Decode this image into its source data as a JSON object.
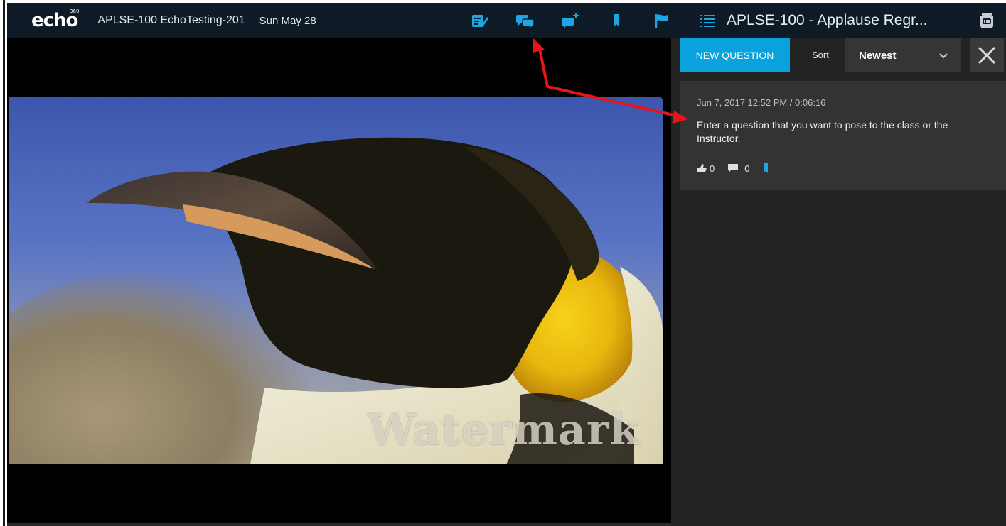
{
  "header": {
    "logo": "echo",
    "logo_sup": "360",
    "course": "APLSE-100 EchoTesting-201",
    "date": "Sun May 28"
  },
  "toolbar": {
    "icons": [
      "notes-icon",
      "discussions-icon",
      "add-question-icon",
      "bookmark-icon",
      "flag-icon"
    ]
  },
  "video": {
    "watermark": "Watermark"
  },
  "panel": {
    "title": "APLSE-100 - Applause Regr...",
    "new_question_label": "NEW QUESTION",
    "sort_label": "Sort",
    "sort_value": "Newest",
    "question": {
      "meta": "Jun 7, 2017 12:52 PM  /  0:06:16",
      "text": "Enter a question that you want to pose to the class or the Instructor.",
      "likes": "0",
      "replies": "0"
    }
  },
  "colors": {
    "accent": "#0aa2dc",
    "topbar": "#0f1a27",
    "panel_bg": "#232323",
    "card_bg": "#333333",
    "annotation": "#e8141b"
  }
}
